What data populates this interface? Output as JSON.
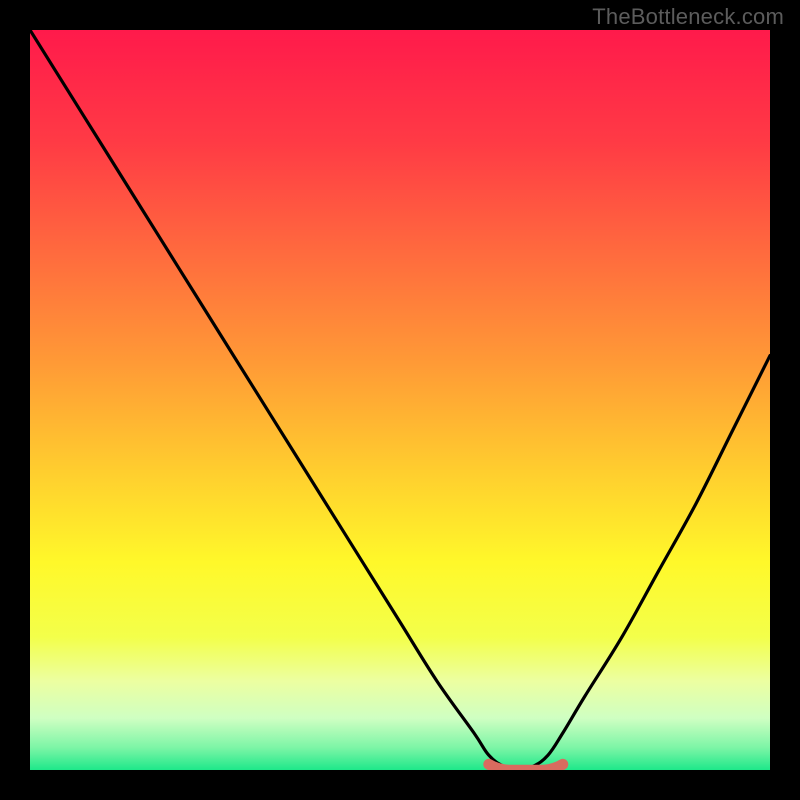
{
  "attribution": "TheBottleneck.com",
  "chart_data": {
    "type": "line",
    "title": "",
    "xlabel": "",
    "ylabel": "",
    "xlim": [
      0,
      100
    ],
    "ylim": [
      0,
      100
    ],
    "x": [
      0,
      5,
      10,
      15,
      20,
      25,
      30,
      35,
      40,
      45,
      50,
      55,
      60,
      62,
      64,
      66,
      68,
      70,
      72,
      75,
      80,
      85,
      90,
      95,
      100
    ],
    "values": [
      100,
      92,
      84,
      76,
      68,
      60,
      52,
      44,
      36,
      28,
      20,
      12,
      5,
      2,
      0.5,
      0,
      0.5,
      2,
      5,
      10,
      18,
      27,
      36,
      46,
      56
    ],
    "annotations": [
      {
        "type": "marker-segment",
        "x_start": 62,
        "x_end": 72,
        "y": 0.5,
        "color": "#d96b5f"
      }
    ],
    "gradient_stops": [
      {
        "pos": 0.0,
        "color": "#ff1a4b"
      },
      {
        "pos": 0.15,
        "color": "#ff3a45"
      },
      {
        "pos": 0.3,
        "color": "#ff6a3e"
      },
      {
        "pos": 0.45,
        "color": "#ff9a36"
      },
      {
        "pos": 0.6,
        "color": "#ffcf2e"
      },
      {
        "pos": 0.72,
        "color": "#fff82a"
      },
      {
        "pos": 0.82,
        "color": "#f3ff4a"
      },
      {
        "pos": 0.88,
        "color": "#ecffa1"
      },
      {
        "pos": 0.93,
        "color": "#cfffc2"
      },
      {
        "pos": 0.97,
        "color": "#7cf5a6"
      },
      {
        "pos": 1.0,
        "color": "#1ee88a"
      }
    ]
  }
}
